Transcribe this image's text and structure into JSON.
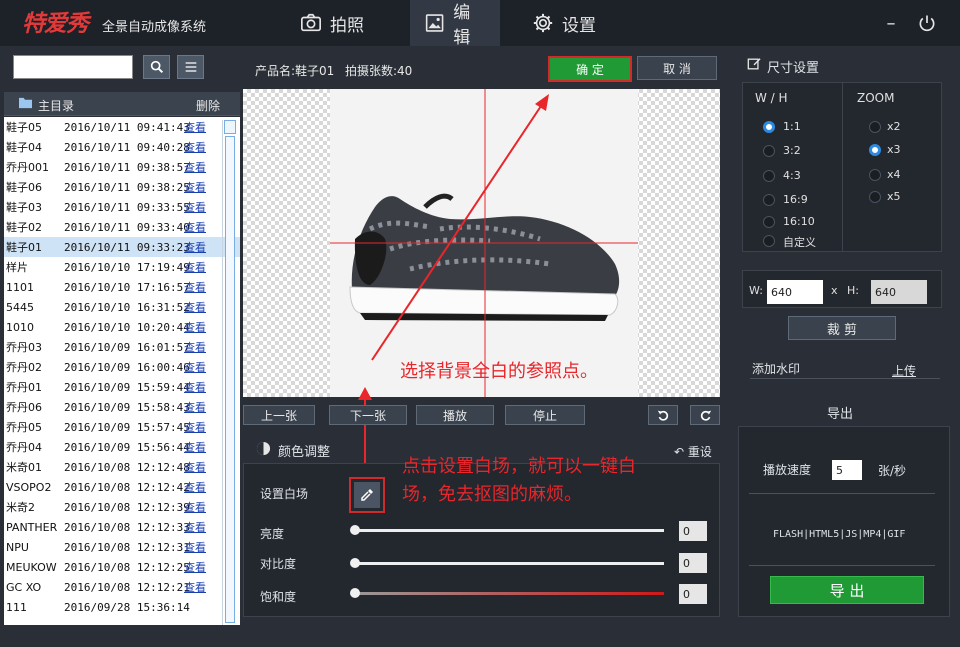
{
  "app": {
    "logo": "特爱秀",
    "subtitle": "全景自动成像系统"
  },
  "nav": [
    {
      "label": "拍照",
      "icon": "camera-icon"
    },
    {
      "label": "编辑",
      "icon": "image-edit-icon"
    },
    {
      "label": "设置",
      "icon": "gear-icon"
    }
  ],
  "window": {
    "minimize": "–",
    "power": "⏻"
  },
  "left": {
    "search_value": "",
    "header_title": "主目录",
    "delete_label": "删除",
    "rows": [
      {
        "name": "鞋子05",
        "time": "2016/10/11 09:41:43",
        "link": "查看"
      },
      {
        "name": "鞋子04",
        "time": "2016/10/11 09:40:28",
        "link": "查看"
      },
      {
        "name": "乔丹001",
        "time": "2016/10/11 09:38:57",
        "link": "查看"
      },
      {
        "name": "鞋子06",
        "time": "2016/10/11 09:38:25",
        "link": "查看"
      },
      {
        "name": "鞋子03",
        "time": "2016/10/11 09:33:55",
        "link": "查看"
      },
      {
        "name": "鞋子02",
        "time": "2016/10/11 09:33:40",
        "link": "查看"
      },
      {
        "name": "鞋子01",
        "time": "2016/10/11 09:33:23",
        "link": "查看"
      },
      {
        "name": "样片",
        "time": "2016/10/10 17:19:49",
        "link": "查看"
      },
      {
        "name": "1101",
        "time": "2016/10/10 17:16:57",
        "link": "查看"
      },
      {
        "name": "5445",
        "time": "2016/10/10 16:31:52",
        "link": "查看"
      },
      {
        "name": "1010",
        "time": "2016/10/10 10:20:44",
        "link": "查看"
      },
      {
        "name": "乔丹03",
        "time": "2016/10/09 16:01:57",
        "link": "查看"
      },
      {
        "name": "乔丹02",
        "time": "2016/10/09 16:00:46",
        "link": "查看"
      },
      {
        "name": "乔丹01",
        "time": "2016/10/09 15:59:44",
        "link": "查看"
      },
      {
        "name": "乔丹06",
        "time": "2016/10/09 15:58:43",
        "link": "查看"
      },
      {
        "name": "乔丹05",
        "time": "2016/10/09 15:57:45",
        "link": "查看"
      },
      {
        "name": "乔丹04",
        "time": "2016/10/09 15:56:44",
        "link": "查看"
      },
      {
        "name": "米奇01",
        "time": "2016/10/08 12:12:48",
        "link": "查看"
      },
      {
        "name": "VSOPO2",
        "time": "2016/10/08 12:12:42",
        "link": "查看"
      },
      {
        "name": "米奇2",
        "time": "2016/10/08 12:12:39",
        "link": "查看"
      },
      {
        "name": "PANTHER",
        "time": "2016/10/08 12:12:33",
        "link": "查看"
      },
      {
        "name": "NPU",
        "time": "2016/10/08 12:12:31",
        "link": "查看"
      },
      {
        "name": "MEUKOW",
        "time": "2016/10/08 12:12:25",
        "link": "查看"
      },
      {
        "name": "GC XO",
        "time": "2016/10/08 12:12:21",
        "link": "查看"
      },
      {
        "name": "111",
        "time": "2016/09/28 15:36:14",
        "link": ""
      }
    ]
  },
  "center": {
    "product_label": "产品名:鞋子01",
    "count_label": "拍摄张数:40",
    "confirm": "确 定",
    "cancel": "取 消",
    "annotation_top": "选择背景全白的参照点。",
    "annotation_bottom": "点击设置白场，就可以一键白场，免去抠图的麻烦。",
    "prev": "上一张",
    "next": "下一张",
    "play": "播放",
    "stop": "停止",
    "color_title": "颜色调整",
    "reset": "重设",
    "white_balance": "设置白场",
    "sliders": [
      {
        "label": "亮度",
        "value": "0"
      },
      {
        "label": "对比度",
        "value": "0"
      },
      {
        "label": "饱和度",
        "value": "0"
      }
    ]
  },
  "right": {
    "size_title": "尺寸设置",
    "wh_title": "W / H",
    "zoom_title": "ZOOM",
    "ratios": [
      {
        "label": "1:1",
        "selected": true
      },
      {
        "label": "3:2",
        "selected": false
      },
      {
        "label": "4:3",
        "selected": false
      },
      {
        "label": "16:9",
        "selected": false
      },
      {
        "label": "16:10",
        "selected": false
      },
      {
        "label": "自定义",
        "selected": false
      }
    ],
    "zooms": [
      {
        "label": "x2",
        "selected": false
      },
      {
        "label": "x3",
        "selected": true
      },
      {
        "label": "x4",
        "selected": false
      },
      {
        "label": "x5",
        "selected": false
      }
    ],
    "w_label": "W:",
    "w_value": "640",
    "x_label": "x",
    "h_label": "H:",
    "h_value": "640",
    "crop": "裁 剪",
    "watermark": "添加水印",
    "upload": "上传",
    "export_title": "导出",
    "speed_label": "播放速度",
    "speed_value": "5",
    "speed_unit": "张/秒",
    "formats": "FLASH|HTML5|JS|MP4|GIF",
    "export_btn": "导 出"
  },
  "colors": {
    "accent_green": "#1f9a34",
    "annotation_red": "#e8262b",
    "radio_blue": "#2d8ae0"
  }
}
